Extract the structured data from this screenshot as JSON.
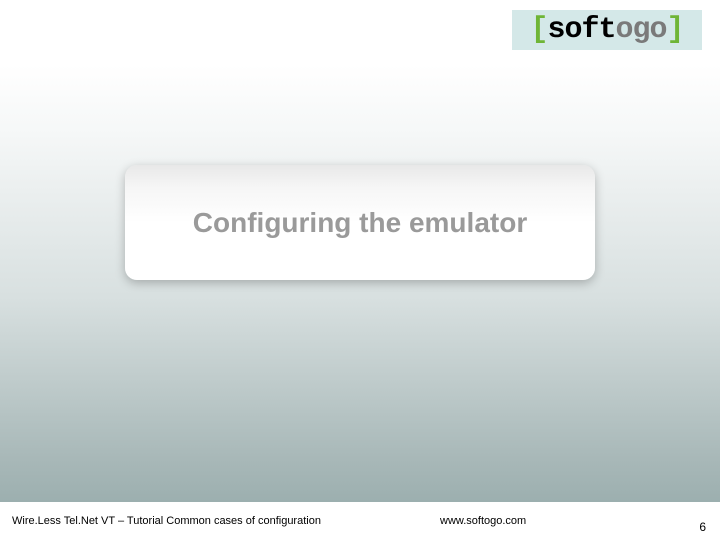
{
  "logo": {
    "bracket_open": "[",
    "soft": "soft",
    "ogo": "ogo",
    "bracket_close": "]"
  },
  "title": "Configuring the emulator",
  "footer": {
    "left": "Wire.Less Tel.Net VT – Tutorial Common cases of configuration",
    "center": "www.softogo.com",
    "page": "6"
  }
}
